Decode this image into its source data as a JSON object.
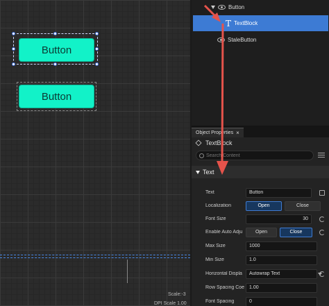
{
  "canvas": {
    "buttons": [
      "Button",
      "Button"
    ],
    "scale_label": "Scale:-3",
    "dpi_label": "DPI Scale 1.00"
  },
  "hierarchy": {
    "items": [
      {
        "label": "Button"
      },
      {
        "label": "TextBlock"
      },
      {
        "label": "StaleButton"
      }
    ]
  },
  "details": {
    "tab_label": "Object Properties",
    "tab_close": "×",
    "object_name": "TextBlock",
    "search_placeholder": "Search Content",
    "section_title": "Text",
    "props": {
      "text": {
        "label": "Text",
        "value": "Button"
      },
      "localization": {
        "label": "Localization",
        "options": [
          "Open",
          "Close"
        ],
        "selected": "Open"
      },
      "font_size": {
        "label": "Font Size",
        "value": "30"
      },
      "enable_auto_adjust": {
        "label": "Enable Auto Adju",
        "options": [
          "Open",
          "Close"
        ],
        "selected": "Close"
      },
      "max_size": {
        "label": "Max Size",
        "value": "1000"
      },
      "min_size": {
        "label": "Min Size",
        "value": "1.0"
      },
      "horizontal_display": {
        "label": "Horizontal Displa",
        "value": "Autowrap Text"
      },
      "row_spacing": {
        "label": "Row Spacing Coe",
        "value": "1.00"
      },
      "font_spacing": {
        "label": "Font Spacing",
        "value": "0"
      }
    }
  },
  "colors": {
    "button_fill": "#12f2c8",
    "selection": "#3d7bd4",
    "annotation_arrow": "#e5534b"
  }
}
